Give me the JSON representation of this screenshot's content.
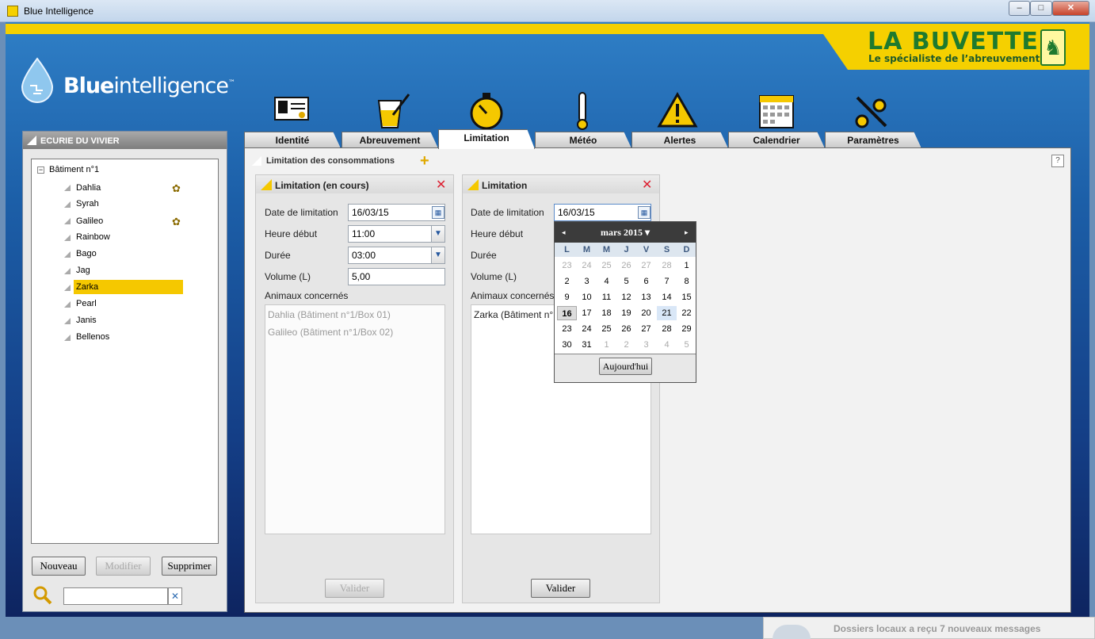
{
  "window": {
    "title": "Blue Intelligence",
    "min": "–",
    "max": "□",
    "close": "✕"
  },
  "brand": {
    "name": "LA BUVETTE",
    "tagline": "Le spécialiste de l’abreuvement",
    "logo_text_bold": "Blue",
    "logo_text": "intelligence",
    "logo_tm": "™"
  },
  "sidebar": {
    "title": "ECURIE DU VIVIER",
    "root": "Bâtiment n°1",
    "root_toggle": "−",
    "horses": [
      "Dahlia",
      "Syrah",
      "Galileo",
      "Rainbow",
      "Bago",
      "Jag",
      "Zarka",
      "Pearl",
      "Janis",
      "Bellenos"
    ],
    "selected": "Zarka",
    "buttons": {
      "new": "Nouveau",
      "edit": "Modifier",
      "delete": "Supprimer"
    },
    "search_placeholder": "",
    "clear": "✕"
  },
  "tabs": [
    "Identité",
    "Abreuvement",
    "Limitation",
    "Météo",
    "Alertes",
    "Calendrier",
    "Paramètres"
  ],
  "tab_icons": [
    "id-card-icon",
    "drink-glass-icon",
    "stopwatch-icon",
    "thermometer-icon",
    "warning-icon",
    "calendar-icon",
    "tools-icon"
  ],
  "active_tab": "Limitation",
  "main": {
    "title": "Limitation des consommations",
    "add": "+",
    "help": "?",
    "current": {
      "title": "Limitation (en cours)",
      "date_label": "Date de limitation",
      "date": "16/03/15",
      "start_label": "Heure début",
      "start": "11:00",
      "duration_label": "Durée",
      "duration": "03:00",
      "volume_label": "Volume (L)",
      "volume": "5,00",
      "animals_label": "Animaux concernés",
      "animals": [
        "Dahlia (Bâtiment n°1/Box 01)",
        "Galileo (Bâtiment n°1/Box 02)"
      ],
      "submit": "Valider"
    },
    "new": {
      "title": "Limitation",
      "date_label": "Date de limitation",
      "date": "16/03/15",
      "start_label": "Heure début",
      "duration_label": "Durée",
      "volume_label": "Volume (L)",
      "animals_label": "Animaux concernés",
      "animals": [
        "Zarka (Bâtiment n°"
      ],
      "submit": "Valider"
    }
  },
  "calendar": {
    "month": "mars 2015 ▾",
    "prev": "◂",
    "next": "▸",
    "days": [
      "L",
      "M",
      "M",
      "J",
      "V",
      "S",
      "D"
    ],
    "weeks": [
      [
        "23",
        "24",
        "25",
        "26",
        "27",
        "28",
        "1"
      ],
      [
        "2",
        "3",
        "4",
        "5",
        "6",
        "7",
        "8"
      ],
      [
        "9",
        "10",
        "11",
        "12",
        "13",
        "14",
        "15"
      ],
      [
        "16",
        "17",
        "18",
        "19",
        "20",
        "21",
        "22"
      ],
      [
        "23",
        "24",
        "25",
        "26",
        "27",
        "28",
        "29"
      ],
      [
        "30",
        "31",
        "1",
        "2",
        "3",
        "4",
        "5"
      ]
    ],
    "today_button": "Aujourd'hui"
  },
  "notification": {
    "text": "Dossiers locaux a reçu 7 nouveaux messages"
  },
  "colors": {
    "accent": "#f5c800",
    "brand_green": "#1e7a2e",
    "frame_blue": "#1c5fa8"
  }
}
